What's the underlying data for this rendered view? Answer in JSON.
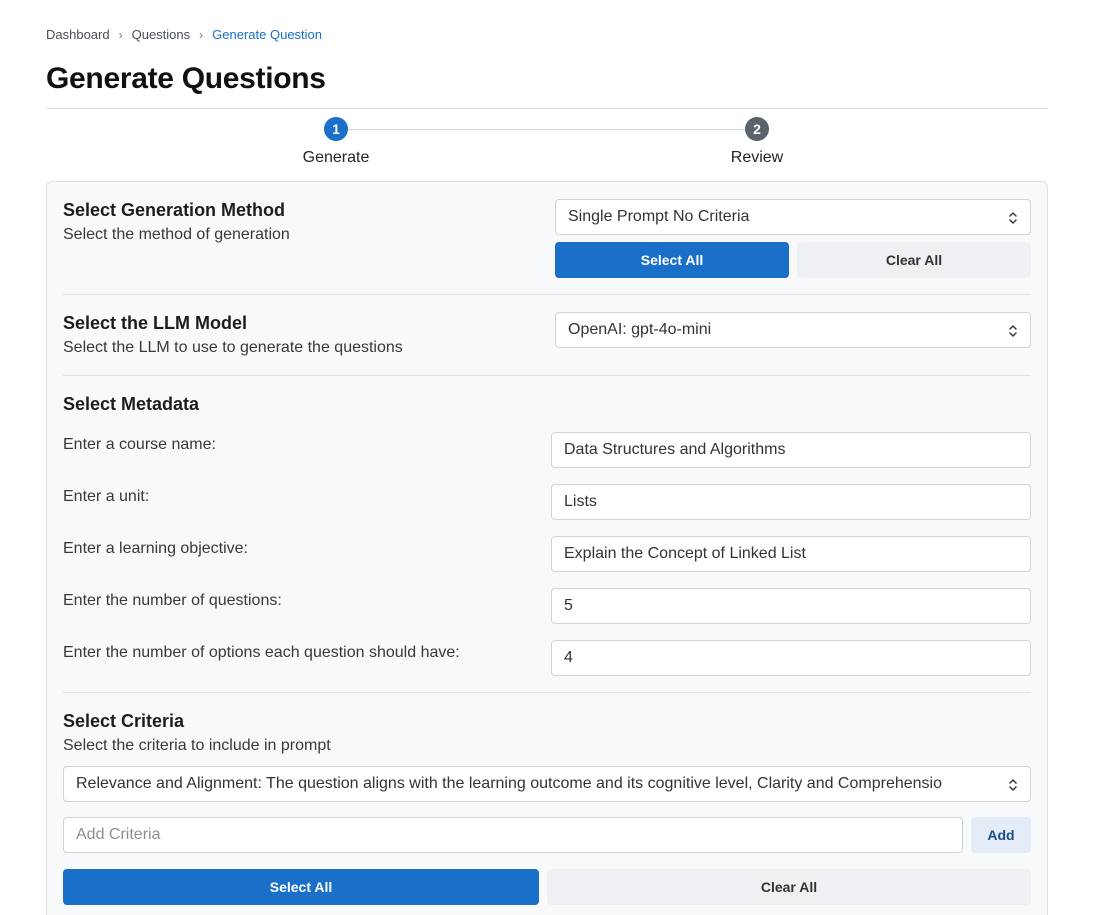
{
  "breadcrumb": {
    "items": [
      "Dashboard",
      "Questions"
    ],
    "current": "Generate Question"
  },
  "page": {
    "title": "Generate Questions"
  },
  "stepper": {
    "steps": [
      {
        "number": "1",
        "label": "Generate"
      },
      {
        "number": "2",
        "label": "Review"
      }
    ]
  },
  "generation_method": {
    "title": "Select Generation Method",
    "subtitle": "Select the method of generation",
    "selected": "Single Prompt No Criteria",
    "select_all_label": "Select All",
    "clear_all_label": "Clear All"
  },
  "llm_model": {
    "title": "Select the LLM Model",
    "subtitle": "Select the LLM to use to generate the questions",
    "selected": "OpenAI: gpt-4o-mini"
  },
  "metadata": {
    "title": "Select Metadata",
    "fields": [
      {
        "label": "Enter a course name:",
        "value": "Data Structures and Algorithms"
      },
      {
        "label": "Enter a unit:",
        "value": "Lists"
      },
      {
        "label": "Enter a learning objective:",
        "value": "Explain the Concept of Linked List"
      },
      {
        "label": "Enter the number of questions:",
        "value": "5"
      },
      {
        "label": "Enter the number of options each question should have:",
        "value": "4"
      }
    ]
  },
  "criteria": {
    "title": "Select Criteria",
    "subtitle": "Select the criteria to include in prompt",
    "selected": "Relevance and Alignment: The question aligns with the learning outcome and its cognitive level, Clarity and Comprehensio",
    "add_placeholder": "Add Criteria",
    "add_label": "Add",
    "select_all_label": "Select All",
    "clear_all_label": "Clear All"
  },
  "icons": {
    "separator": "chevron-right-icon",
    "select": "chevron-up-down-icon"
  },
  "colors": {
    "primary": "#1a6fc9",
    "step_inactive": "#5c636a"
  }
}
